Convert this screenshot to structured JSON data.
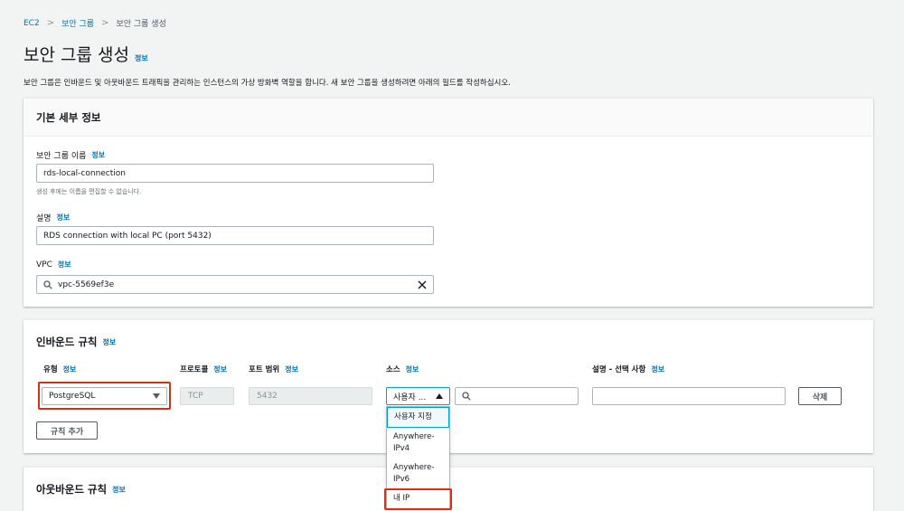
{
  "colors": {
    "link": "#0073bb",
    "highlight": "#d13212",
    "background": "#f2f3f3"
  },
  "breadcrumb": {
    "items": [
      "EC2",
      "보안 그룹",
      "보안 그룹 생성"
    ]
  },
  "page": {
    "title": "보안 그룹 생성",
    "info": "정보",
    "description": "보안 그룹은 인바운드 및 아웃바운드 트래픽을 관리하는 인스턴스의 가상 방화벽 역할을 합니다. 새 보안 그룹을 생성하려면 아래의 필드를 작성하십시오."
  },
  "basic": {
    "title": "기본 세부 정보",
    "name_label": "보안 그룹 이름",
    "name_value": "rds-local-connection",
    "name_hint": "생성 후에는 이름을 편집할 수 없습니다.",
    "desc_label": "설명",
    "desc_value": "RDS connection with local PC (port 5432)",
    "vpc_label": "VPC",
    "vpc_value": "vpc-5569ef3e",
    "info": "정보"
  },
  "inbound": {
    "title": "인바운드 규칙",
    "info": "정보",
    "columns": {
      "type": "유형",
      "protocol": "프로토콜",
      "port_range": "포트 범위",
      "source": "소스",
      "description": "설명 - 선택 사항"
    },
    "rule": {
      "type": "PostgreSQL",
      "protocol": "TCP",
      "port": "5432",
      "source": "사용자 ..."
    },
    "delete_label": "삭제",
    "add_label": "규칙 추가",
    "source_options": [
      "사용자 지정",
      "Anywhere-IPv4",
      "Anywhere-IPv6",
      "내 IP"
    ]
  },
  "outbound": {
    "title": "아웃바운드 규칙",
    "info": "정보"
  }
}
